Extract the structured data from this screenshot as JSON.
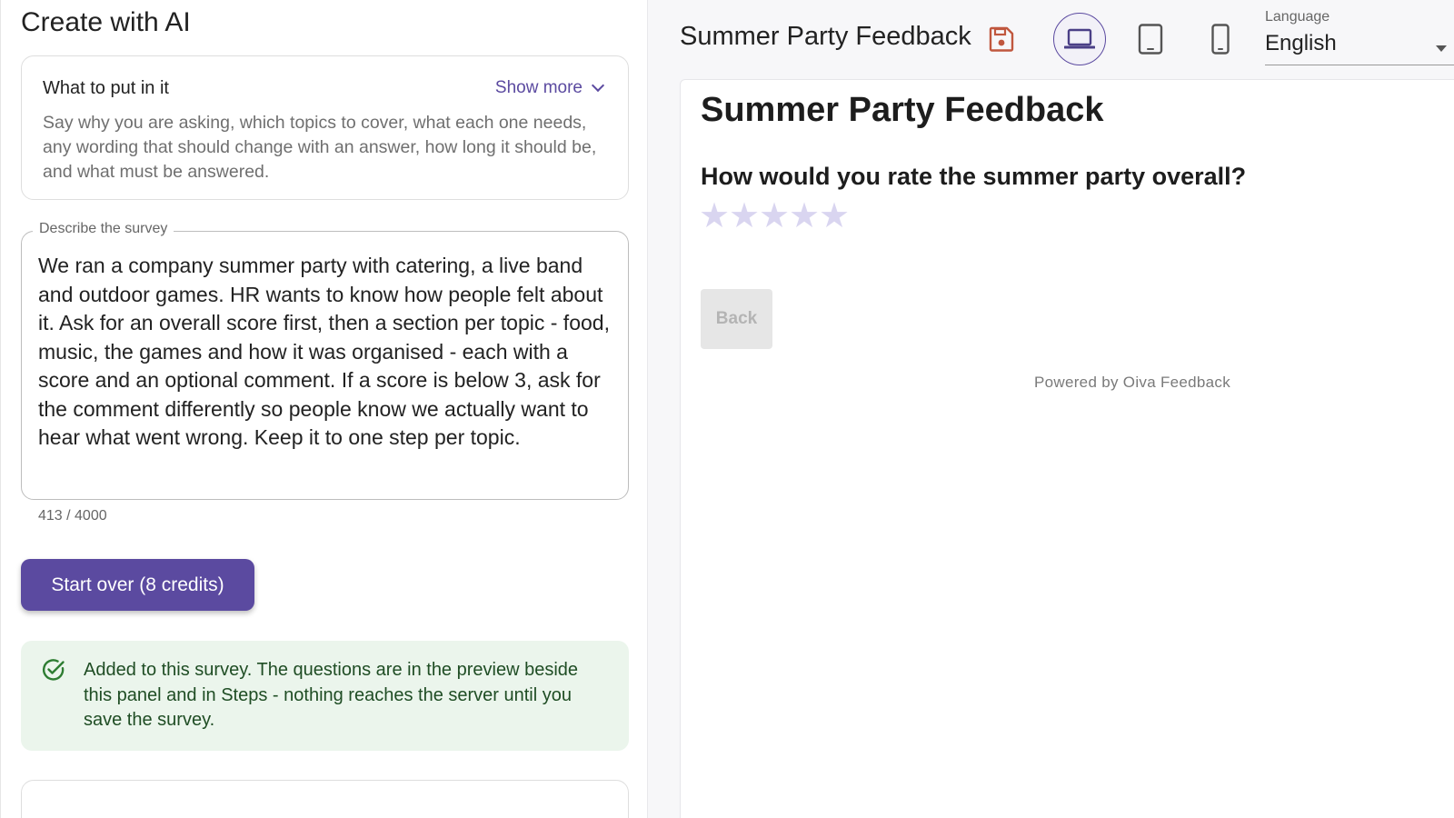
{
  "left_panel": {
    "title": "Create with AI",
    "tips": {
      "heading": "What to put in it",
      "toggle_label": "Show more",
      "toggle_icon": "chevron-down-icon",
      "body": "Say why you are asking, which topics to cover, what each one needs, any wording that should change with an answer, how long it should be, and what must be answered."
    },
    "describe": {
      "label": "Describe the survey",
      "value": "We ran a company summer party with catering, a live band and outdoor games. HR wants to know how people felt about it. Ask for an overall score first, then a section per topic - food, music, the games and how it was organised - each with a score and an optional comment. If a score is below 3, ask for the comment differently so people know we actually want to hear what went wrong. Keep it to one step per topic.",
      "char_count": "413 / 4000"
    },
    "start_over_label": "Start over (8 credits)",
    "success_message": "Added to this survey. The questions are in the preview beside this panel and in Steps - nothing reaches the server until you save the survey.",
    "success_icon": "check-circle-icon"
  },
  "preview": {
    "title": "Summer Party Feedback",
    "save_icon": "save-icon",
    "devices": [
      {
        "name": "desktop",
        "icon": "laptop-icon",
        "active": true
      },
      {
        "name": "tablet",
        "icon": "tablet-icon",
        "active": false
      },
      {
        "name": "mobile",
        "icon": "phone-icon",
        "active": false
      }
    ],
    "language": {
      "label": "Language",
      "value": "English"
    },
    "survey": {
      "title": "Summer Party Feedback",
      "question": "How would you rate the summer party overall?",
      "rating_max": 5,
      "rating_value": 0,
      "back_label": "Back",
      "powered_by": "Powered by Oiva Feedback"
    }
  },
  "colors": {
    "accent": "#5b4aa0",
    "success_bg": "#ebf5ec",
    "success_text": "#1f4d24",
    "save_icon": "#c0573e",
    "star_empty": "#d9d5f0"
  }
}
